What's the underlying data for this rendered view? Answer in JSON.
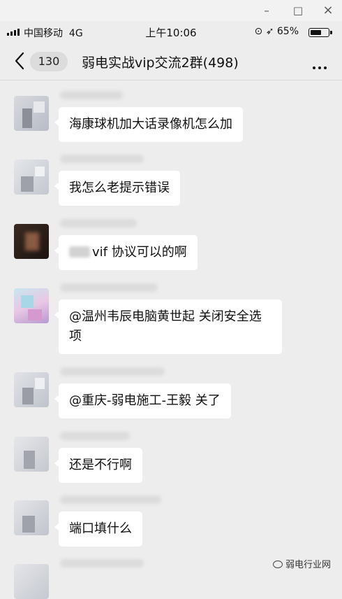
{
  "window": {
    "minimize_icon": "–",
    "maximize_icon": "□",
    "close_icon": "×"
  },
  "status": {
    "carrier": "中国移动",
    "network": "4G",
    "time": "上午10:06",
    "battery": "65%",
    "battery_level": 0.65
  },
  "nav": {
    "unread_count": "130",
    "title": "弱电实战vip交流2群(498)"
  },
  "messages": [
    {
      "text": "海康球机加大话录像机怎么加"
    },
    {
      "text": "我怎么老提示错误"
    },
    {
      "text": "vif 协议可以的啊"
    },
    {
      "text": "@温州韦辰电脑黄世起 关闭安全选项"
    },
    {
      "text": "@重庆-弱电施工-王毅 关了"
    },
    {
      "text": "还是不行啊"
    },
    {
      "text": "端口填什么"
    }
  ],
  "watermark": {
    "text": "弱电行业网"
  }
}
